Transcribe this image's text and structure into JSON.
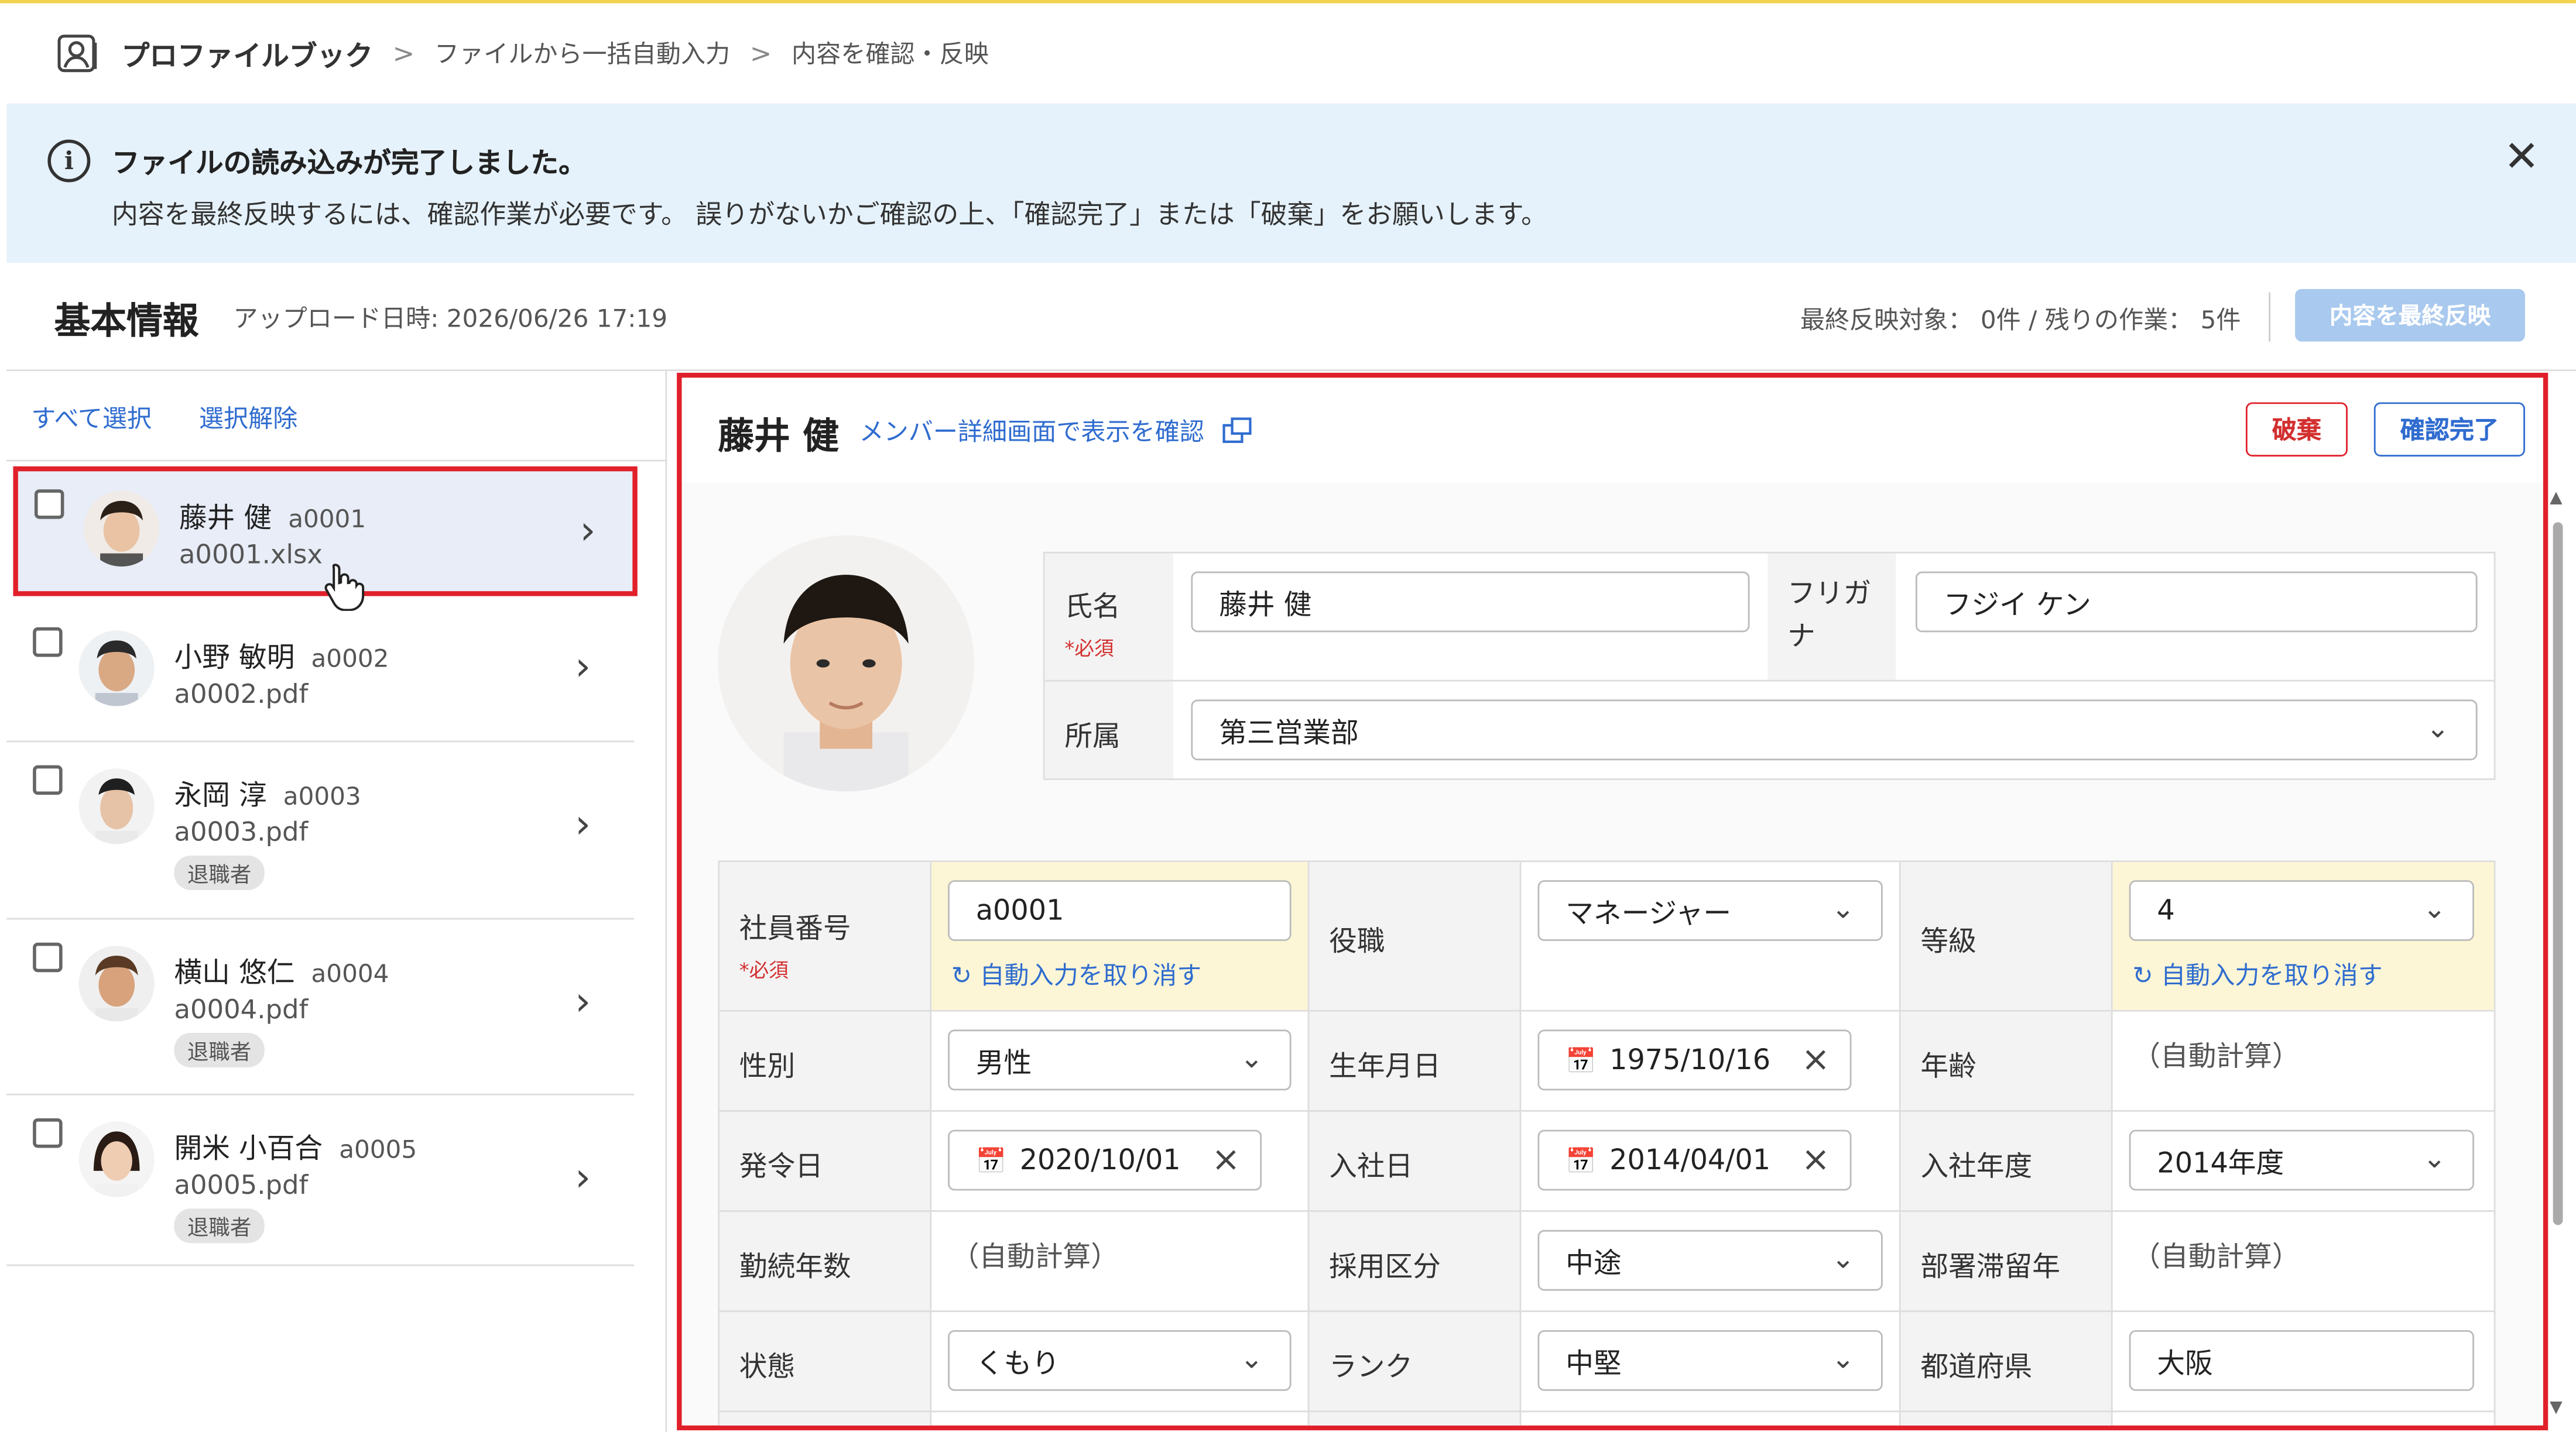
{
  "breadcrumb": {
    "app": "プロファイルブック",
    "items": [
      "ファイルから一括自動入力",
      "内容を確認・反映"
    ]
  },
  "banner": {
    "title": "ファイルの読み込みが完了しました。",
    "message": "内容を最終反映するには、確認作業が必要です。 誤りがないかご確認の上、「確認完了」または「破棄」をお願いします。",
    "close": "✕"
  },
  "header": {
    "title": "基本情報",
    "upload_date": "アップロード日時: 2026/06/26 17:19",
    "status": "最終反映対象： 0件 / 残りの作業： 5件",
    "final_button": "内容を最終反映"
  },
  "left": {
    "select_all": "すべて選択",
    "deselect": "選択解除",
    "members": [
      {
        "name": "藤井 健",
        "code": "a0001",
        "file": "a0001.xlsx",
        "retired": ""
      },
      {
        "name": "小野 敏明",
        "code": "a0002",
        "file": "a0002.pdf",
        "retired": ""
      },
      {
        "name": "永岡 淳",
        "code": "a0003",
        "file": "a0003.pdf",
        "retired": "退職者"
      },
      {
        "name": "横山 悠仁",
        "code": "a0004",
        "file": "a0004.pdf",
        "retired": "退職者"
      },
      {
        "name": "開米 小百合",
        "code": "a0005",
        "file": "a0005.pdf",
        "retired": "退職者"
      }
    ]
  },
  "detail": {
    "name": "藤井 健",
    "member_link": "メンバー詳細画面で表示を確認",
    "discard": "破棄",
    "confirm": "確認完了",
    "required": "*必須",
    "undo": "自動入力を取り消す",
    "auto_calc": "（自動計算）",
    "fields": {
      "name_label": "氏名",
      "name_value": "藤井 健",
      "kana_label_1": "フリガ",
      "kana_label_2": "ナ",
      "kana_value": "フジイ ケン",
      "dept_label": "所属",
      "dept_value": "第三営業部",
      "emp_no_label": "社員番号",
      "emp_no_value": "a0001",
      "position_label": "役職",
      "position_value": "マネージャー",
      "grade_label": "等級",
      "grade_value": "4",
      "gender_label": "性別",
      "gender_value": "男性",
      "birth_label": "生年月日",
      "birth_value": "1975/10/16",
      "age_label": "年齢",
      "appoint_label": "発令日",
      "appoint_value": "2020/10/01",
      "join_label": "入社日",
      "join_value": "2014/04/01",
      "join_year_label": "入社年度",
      "join_year_value": "2014年度",
      "tenure_label": "勤続年数",
      "hire_type_label": "採用区分",
      "hire_type_value": "中途",
      "dept_stay_label": "部署滞留年",
      "status_label": "状態",
      "status_value": "くもり",
      "rank_label": "ランク",
      "rank_value": "中堅",
      "pref_label": "都道府県",
      "pref_value": "大阪"
    }
  },
  "colors": {
    "accent": "#2f6ccf",
    "danger": "#e0202a",
    "banner_bg": "#e6f2fb",
    "highlight": "#fdf6d6"
  }
}
